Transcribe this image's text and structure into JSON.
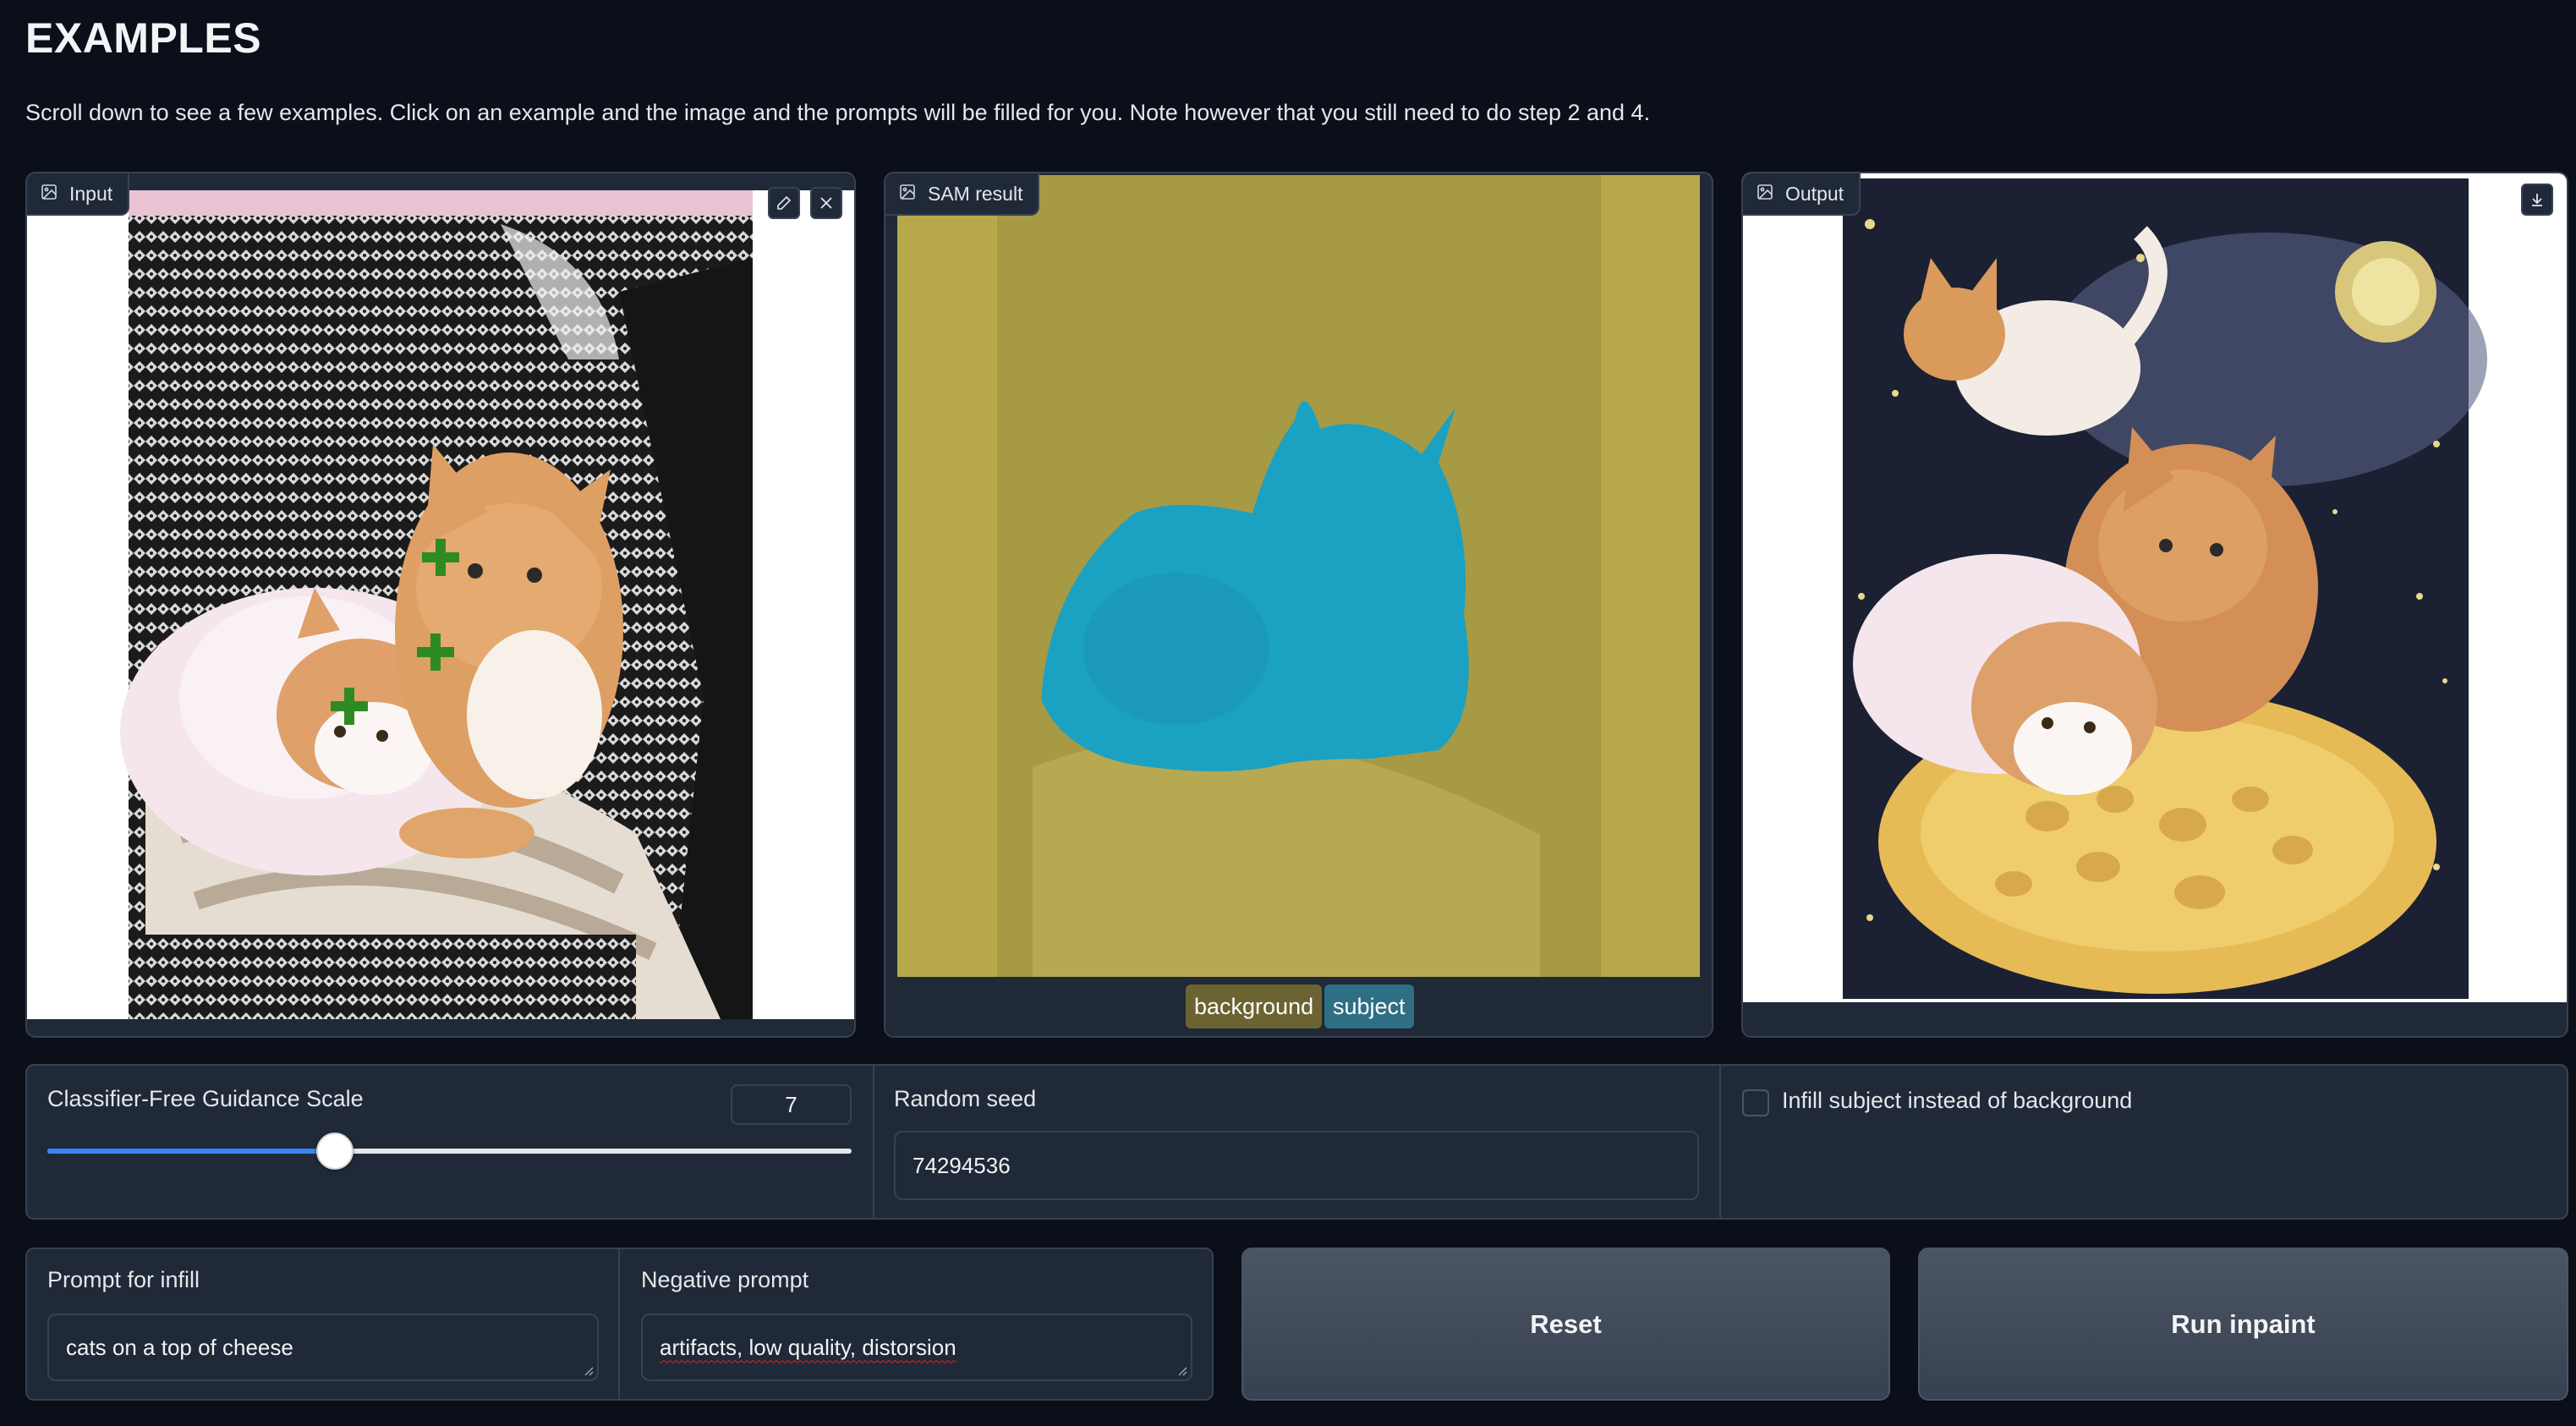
{
  "page": {
    "title": "EXAMPLES",
    "description": "Scroll down to see a few examples. Click on an example and the image and the prompts will be filled for you. Note however that you still need to do step 2 and 4."
  },
  "panels": {
    "input": {
      "label": "Input",
      "icon": "image-icon"
    },
    "sam": {
      "label": "SAM result",
      "icon": "image-icon"
    },
    "output": {
      "label": "Output",
      "icon": "image-icon"
    }
  },
  "legend": {
    "background": "background",
    "subject": "subject"
  },
  "controls": {
    "cfg_label": "Classifier-Free Guidance Scale",
    "cfg_value": "7",
    "cfg_fraction": 0.357,
    "seed_label": "Random seed",
    "seed_value": "74294536",
    "infill_label": "Infill subject instead of background",
    "infill_checked": false
  },
  "prompts": {
    "infill_label": "Prompt for infill",
    "infill_value": "cats on a top of cheese",
    "negative_label": "Negative prompt",
    "negative_value": "artifacts, low quality, distorsion"
  },
  "buttons": {
    "reset": "Reset",
    "run": "Run inpaint"
  },
  "colors": {
    "accent": "#3b82f6",
    "mask_background": "#b9a94b",
    "mask_subject": "#1ba1c2",
    "tag_background": "#6b6331",
    "tag_subject": "#2f6f84"
  }
}
